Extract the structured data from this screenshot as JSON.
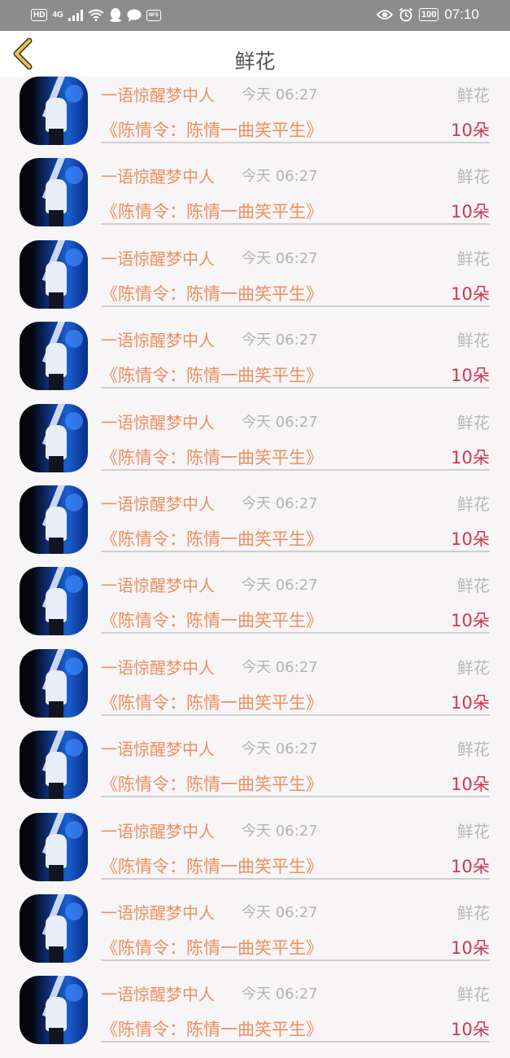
{
  "status_bar": {
    "left_icons": [
      "HD",
      "4G",
      "signal-icon",
      "wifi-icon",
      "qq-icon",
      "chat-icon",
      "nfs-icon"
    ],
    "hd": "HD",
    "net": "4G",
    "nfs": "NFS",
    "battery": "100",
    "time": "07:10"
  },
  "header": {
    "title": "鲜花",
    "back_icon": "chevron-left-icon",
    "back_color": "#e8c24d"
  },
  "list": {
    "items": [
      {
        "name": "一语惊醒梦中人",
        "time": "今天 06:27",
        "gift": "鲜花",
        "song": "《陈情令：陈情一曲笑平生》",
        "count": "10朵"
      },
      {
        "name": "一语惊醒梦中人",
        "time": "今天 06:27",
        "gift": "鲜花",
        "song": "《陈情令：陈情一曲笑平生》",
        "count": "10朵"
      },
      {
        "name": "一语惊醒梦中人",
        "time": "今天 06:27",
        "gift": "鲜花",
        "song": "《陈情令：陈情一曲笑平生》",
        "count": "10朵"
      },
      {
        "name": "一语惊醒梦中人",
        "time": "今天 06:27",
        "gift": "鲜花",
        "song": "《陈情令：陈情一曲笑平生》",
        "count": "10朵"
      },
      {
        "name": "一语惊醒梦中人",
        "time": "今天 06:27",
        "gift": "鲜花",
        "song": "《陈情令：陈情一曲笑平生》",
        "count": "10朵"
      },
      {
        "name": "一语惊醒梦中人",
        "time": "今天 06:27",
        "gift": "鲜花",
        "song": "《陈情令：陈情一曲笑平生》",
        "count": "10朵"
      },
      {
        "name": "一语惊醒梦中人",
        "time": "今天 06:27",
        "gift": "鲜花",
        "song": "《陈情令：陈情一曲笑平生》",
        "count": "10朵"
      },
      {
        "name": "一语惊醒梦中人",
        "time": "今天 06:27",
        "gift": "鲜花",
        "song": "《陈情令：陈情一曲笑平生》",
        "count": "10朵"
      },
      {
        "name": "一语惊醒梦中人",
        "time": "今天 06:27",
        "gift": "鲜花",
        "song": "《陈情令：陈情一曲笑平生》",
        "count": "10朵"
      },
      {
        "name": "一语惊醒梦中人",
        "time": "今天 06:27",
        "gift": "鲜花",
        "song": "《陈情令：陈情一曲笑平生》",
        "count": "10朵"
      },
      {
        "name": "一语惊醒梦中人",
        "time": "今天 06:27",
        "gift": "鲜花",
        "song": "《陈情令：陈情一曲笑平生》",
        "count": "10朵"
      },
      {
        "name": "一语惊醒梦中人",
        "time": "今天 06:27",
        "gift": "鲜花",
        "song": "《陈情令：陈情一曲笑平生》",
        "count": "10朵"
      }
    ]
  },
  "colors": {
    "name": "#ec8f62",
    "count": "#d7334a",
    "muted": "#b3b3b3"
  }
}
